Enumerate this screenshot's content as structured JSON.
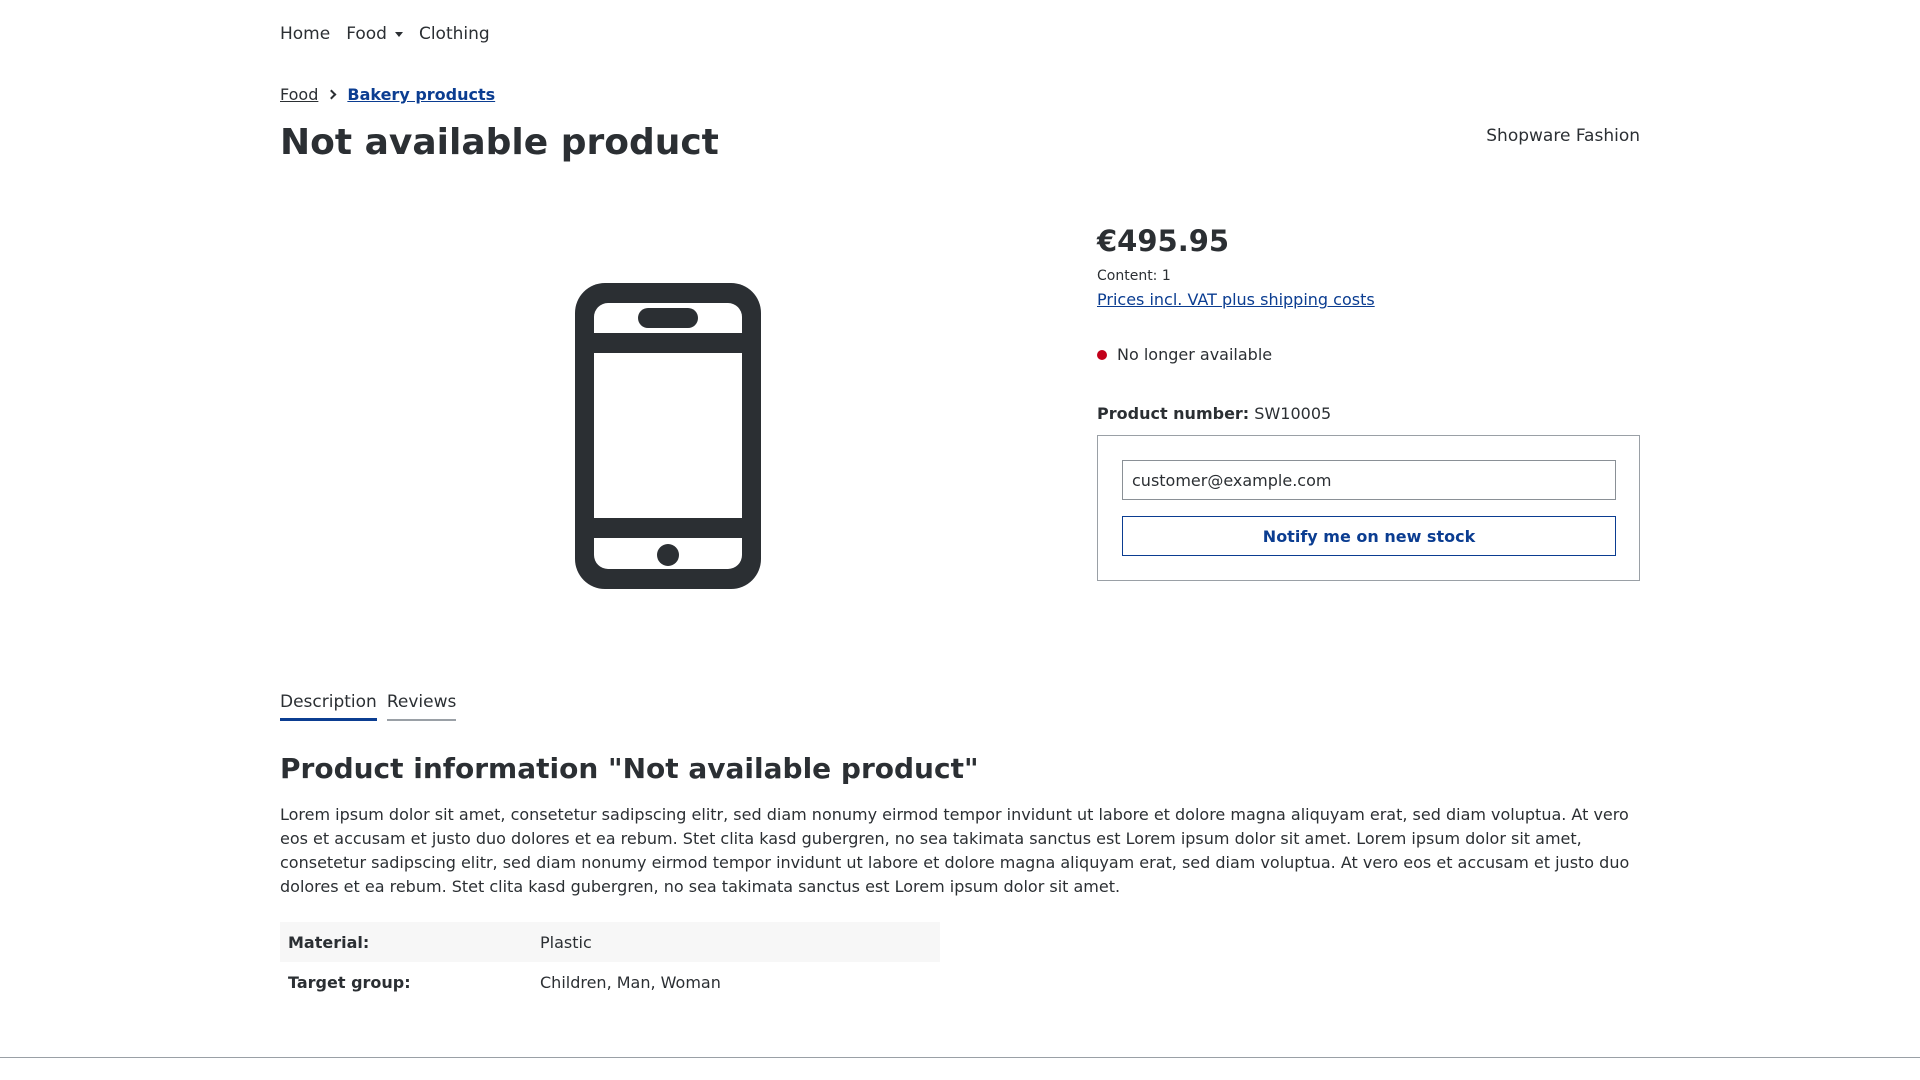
{
  "nav": {
    "items": [
      {
        "label": "Home"
      },
      {
        "label": "Food",
        "has_dropdown": true
      },
      {
        "label": "Clothing"
      }
    ]
  },
  "breadcrumb": {
    "items": [
      "Food",
      "Bakery products"
    ]
  },
  "product": {
    "title": "Not available product",
    "manufacturer": "Shopware Fashion",
    "image_icon": "smartphone-icon",
    "price": "€495.95",
    "content": "Content: 1",
    "tax_link": "Prices incl. VAT plus shipping costs",
    "delivery_status": "No longer available",
    "delivery_status_color": "#c2001a",
    "number_label": "Product number:",
    "number_value": "SW10005"
  },
  "notify": {
    "email_value": "customer@example.com",
    "button_label": "Notify me on new stock"
  },
  "tabs": [
    {
      "label": "Description",
      "active": true
    },
    {
      "label": "Reviews",
      "active": false
    }
  ],
  "description": {
    "title": "Product information \"Not available product\"",
    "text": "Lorem ipsum dolor sit amet, consetetur sadipscing elitr, sed diam nonumy eirmod tempor invidunt ut labore et dolore magna aliquyam erat, sed diam voluptua. At vero eos et accusam et justo duo dolores et ea rebum. Stet clita kasd gubergren, no sea takimata sanctus est Lorem ipsum dolor sit amet. Lorem ipsum dolor sit amet, consetetur sadipscing elitr, sed diam nonumy eirmod tempor invidunt ut labore et dolore magna aliquyam erat, sed diam voluptua. At vero eos et accusam et justo duo dolores et ea rebum. Stet clita kasd gubergren, no sea takimata sanctus est Lorem ipsum dolor sit amet."
  },
  "properties": [
    {
      "label": "Material:",
      "value": "Plastic"
    },
    {
      "label": "Target group:",
      "value": "Children, Man, Woman"
    }
  ],
  "colors": {
    "accent": "#0b3d91",
    "text": "#2b2f33",
    "unavailable": "#c2001a"
  }
}
